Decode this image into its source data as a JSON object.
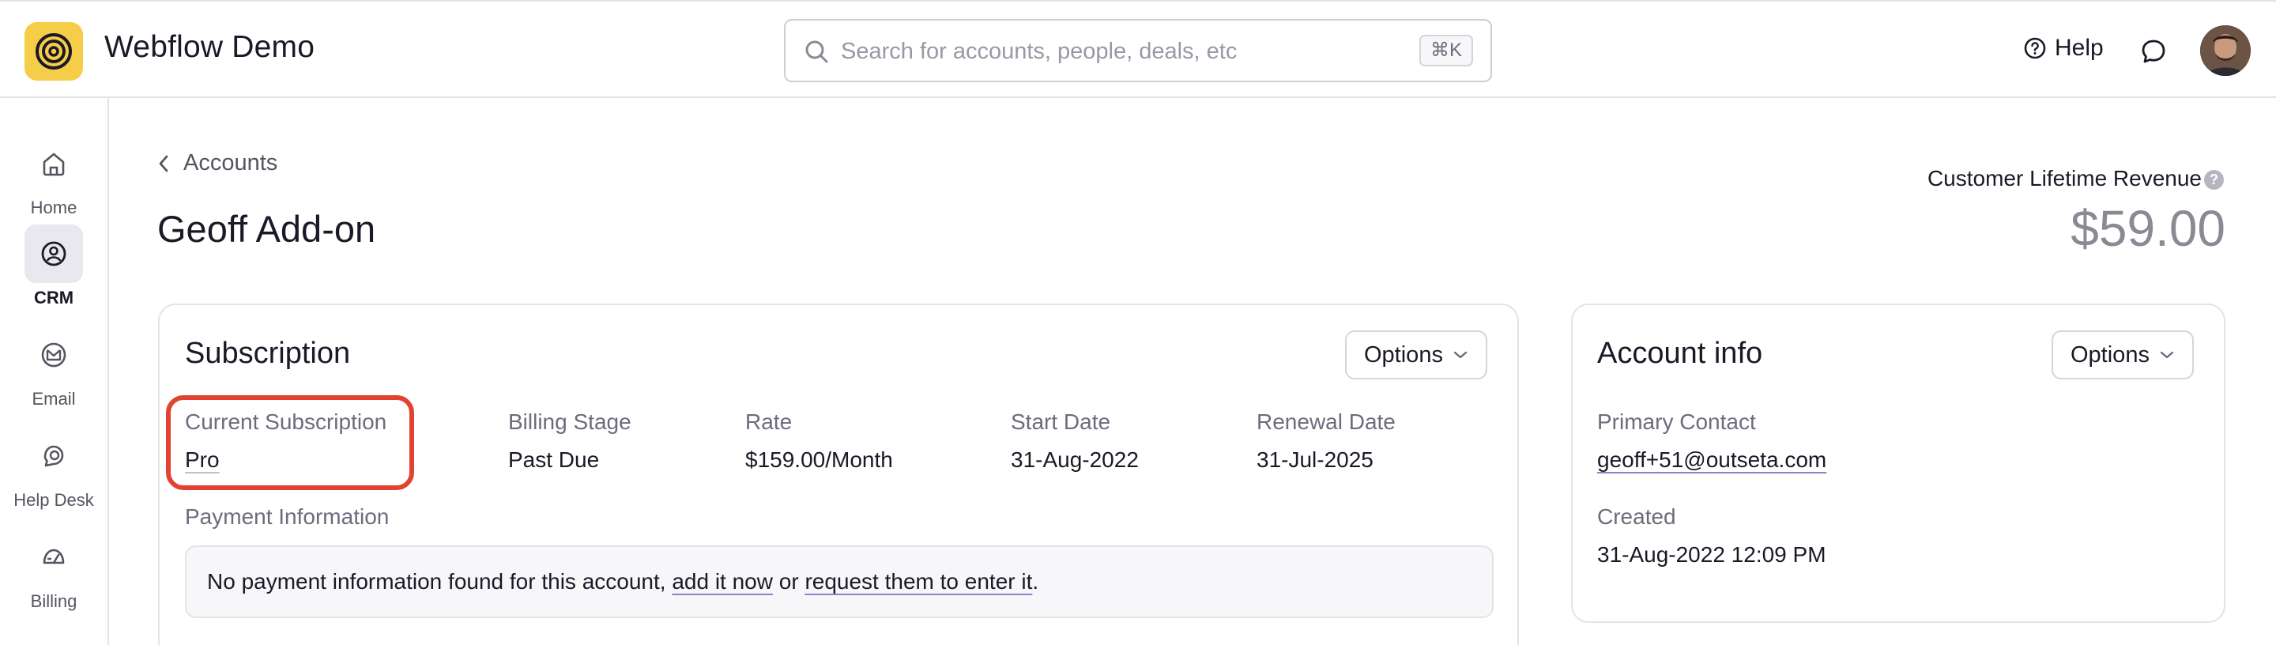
{
  "app": {
    "title": "Webflow Demo"
  },
  "search": {
    "placeholder": "Search for accounts, people, deals, etc",
    "shortcut": "⌘K"
  },
  "header": {
    "help_label": "Help"
  },
  "sidebar": {
    "items": [
      {
        "label": "Home",
        "icon": "home-icon"
      },
      {
        "label": "CRM",
        "icon": "crm-icon",
        "active": true
      },
      {
        "label": "Email",
        "icon": "email-icon"
      },
      {
        "label": "Help Desk",
        "icon": "help-desk-icon"
      },
      {
        "label": "Billing",
        "icon": "billing-icon"
      }
    ]
  },
  "breadcrumb": {
    "label": "Accounts"
  },
  "page": {
    "title": "Geoff Add-on"
  },
  "clv": {
    "label": "Customer Lifetime Revenue",
    "help": "?",
    "value": "$59.00"
  },
  "subscription": {
    "title": "Subscription",
    "options_label": "Options",
    "fields": [
      {
        "label": "Current Subscription",
        "value": "Pro"
      },
      {
        "label": "Billing Stage",
        "value": "Past Due"
      },
      {
        "label": "Rate",
        "value": "$159.00/Month"
      },
      {
        "label": "Start Date",
        "value": "31-Aug-2022"
      },
      {
        "label": "Renewal Date",
        "value": "31-Jul-2025"
      }
    ],
    "payment": {
      "label": "Payment Information",
      "text_before": "No payment information found for this account, ",
      "link_add": "add it now",
      "text_mid": " or ",
      "link_request": "request them to enter it",
      "text_after": "."
    }
  },
  "account_info": {
    "title": "Account info",
    "options_label": "Options",
    "primary_contact_label": "Primary Contact",
    "primary_contact_value": "geoff+51@outseta.com",
    "created_label": "Created",
    "created_value": "31-Aug-2022 12:09 PM"
  },
  "colors": {
    "accent_logo": "#f6cd48",
    "highlight": "#e2432f",
    "text": "#1c1826",
    "muted": "#6f6a7c"
  }
}
